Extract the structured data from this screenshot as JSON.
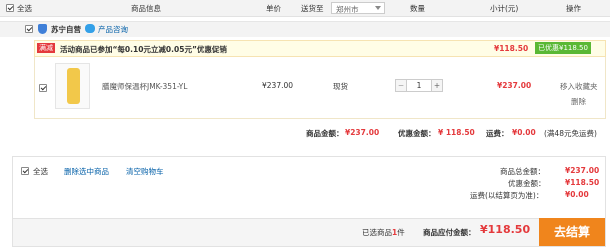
{
  "header": {
    "select_all": "全选",
    "product_info": "商品信息",
    "unit_price": "单价",
    "ship_to": "送货至",
    "city": "郑州市",
    "quantity": "数量",
    "subtotal": "小计(元)",
    "actions": "操作"
  },
  "store": {
    "name": "苏宁自营",
    "consult": "产品咨询"
  },
  "promo": {
    "tag": "满减",
    "text": "活动商品已参加“每0.10元立减0.05元”优惠促销",
    "amount": "¥118.50",
    "discount_badge": "已优惠¥118.50"
  },
  "item": {
    "name": "膳魔师保温杯JMK-351-YL",
    "price": "¥237.00",
    "stock": "现货",
    "qty": "1",
    "minus": "−",
    "plus": "+",
    "subtotal": "¥237.00",
    "favorite": "移入收藏夹",
    "delete": "删除"
  },
  "summary": {
    "goods_label": "商品金额：",
    "goods_value": "¥237.00",
    "discount_label": "优惠金额：",
    "discount_value": "¥ 118.50",
    "shipping_label": "运费：",
    "shipping_value": "¥0.00",
    "free_note": "(满48元免运费)"
  },
  "bottom": {
    "select_all": "全选",
    "delete_selected": "删除选中商品",
    "clear_cart": "清空购物车",
    "goods_total_label": "商品总金额：",
    "goods_total_value": "¥237.00",
    "discount_label": "优惠金额：",
    "discount_value": "¥118.50",
    "shipping_label": "运费(以结算页为准)：",
    "shipping_value": "¥0.00",
    "selected_prefix": "已选商品",
    "selected_count": "1",
    "selected_suffix": "件",
    "payable_label": "商品应付金额：",
    "payable_value": "¥118.50",
    "checkout": "去结算"
  },
  "colors": {
    "accent_red": "#e4393c",
    "checkout_orange": "#f0851c",
    "badge_green": "#5ab834",
    "promo_bg": "#fffde6",
    "header_bg": "#f3f3f3"
  }
}
